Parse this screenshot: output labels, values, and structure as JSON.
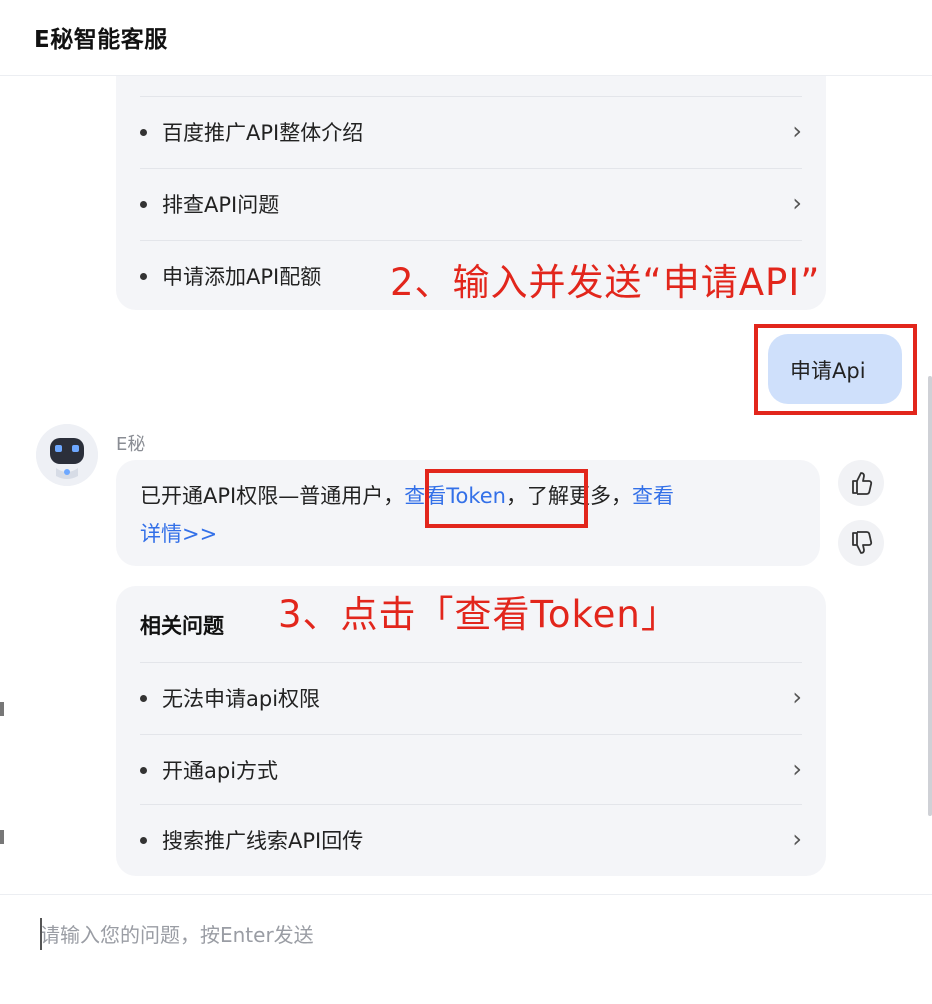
{
  "header": {
    "title": "E秘智能客服"
  },
  "top_card": {
    "items": [
      {
        "label": "百度推广API整体介绍",
        "chevron": "›"
      },
      {
        "label": "排查API问题",
        "chevron": "›"
      },
      {
        "label": "申请添加API配额",
        "chevron": "›"
      }
    ]
  },
  "user_message": {
    "text": "申请Api"
  },
  "bot": {
    "name": "E秘",
    "answer": {
      "part1": "已开通API权限—普通用户，",
      "token_link": "查看Token",
      "part2": "，了解更多，",
      "details_link_a": "查看",
      "details_link_b": "详情>>"
    },
    "feedback": {
      "like_icon": "thumbs-up-icon",
      "dislike_icon": "thumbs-down-icon"
    }
  },
  "related": {
    "title": "相关问题",
    "items": [
      {
        "label": "无法申请api权限",
        "chevron": "›"
      },
      {
        "label": "开通api方式",
        "chevron": "›"
      },
      {
        "label": "搜索推广线索API回传",
        "chevron": "›"
      }
    ]
  },
  "annotations": {
    "step2": "2、输入并发送“申请API”",
    "step3": "3、点击「查看Token」",
    "color": "#e2261c"
  },
  "input": {
    "placeholder": "请输入您的问题，按Enter发送"
  },
  "colors": {
    "accent": "#3370e8",
    "user_bubble": "#cfe0fb",
    "card_bg": "#f4f5f8"
  }
}
